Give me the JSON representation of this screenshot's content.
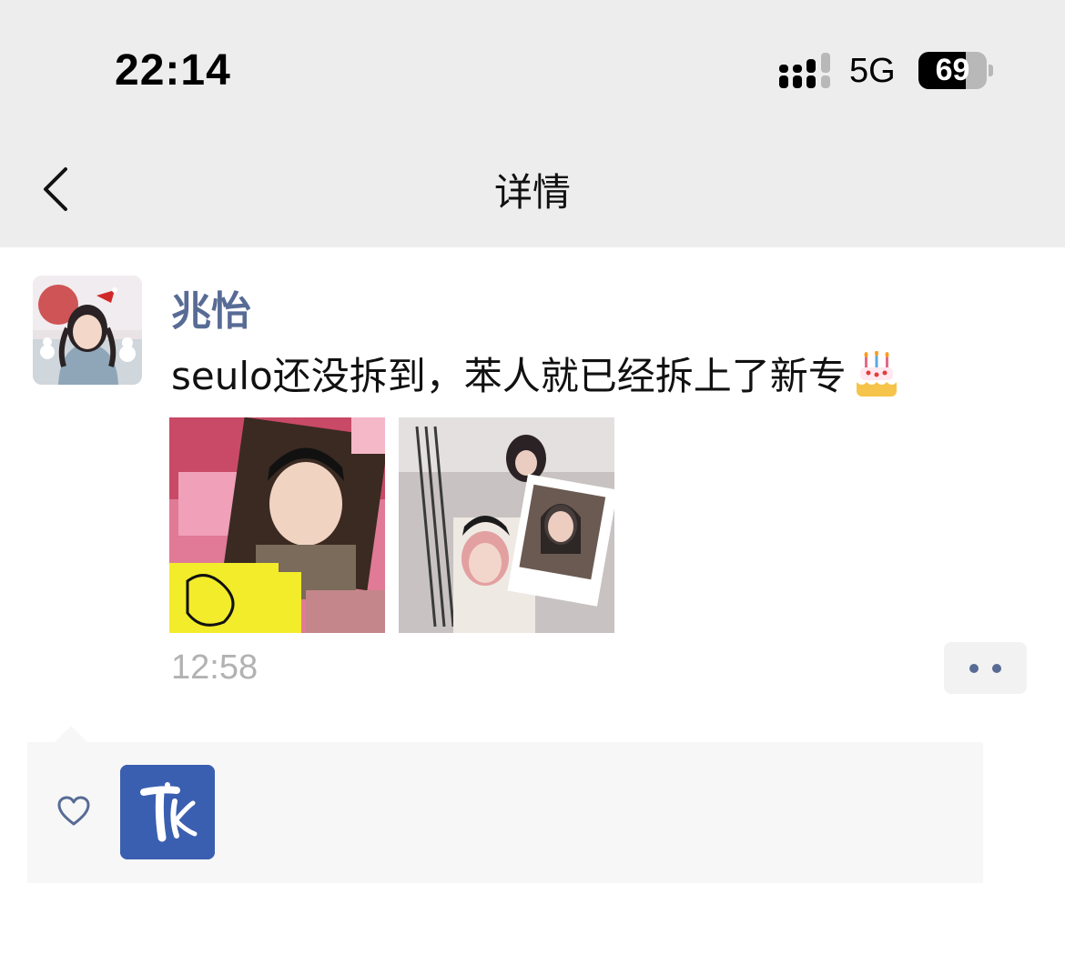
{
  "status_bar": {
    "time": "22:14",
    "network": "5G",
    "battery": "69",
    "battery_level": 0.69
  },
  "nav": {
    "title": "详情"
  },
  "post": {
    "author": "兆怡",
    "text": "seulo还没拆到，苯人就已经拆上了新专",
    "emoji": "birthday-cake-icon",
    "photos": [
      {
        "name": "photocard-pink-photo"
      },
      {
        "name": "polaroid-spiral-photo"
      }
    ],
    "time": "12:58"
  },
  "likes": {
    "icon": "heart-icon",
    "users": [
      {
        "avatar": "blue-logo-avatar"
      }
    ]
  },
  "colors": {
    "nav_bg": "#ededed",
    "author_name": "#576b95",
    "time": "#b2b2b2",
    "like_panel": "#f7f7f7",
    "liker_avatar": "#3b5fb0"
  }
}
